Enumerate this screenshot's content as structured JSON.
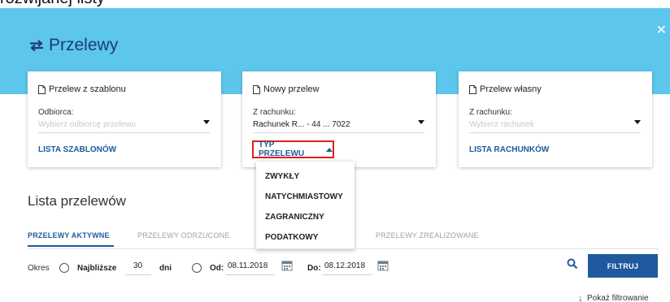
{
  "caption": "rozwijanej listy",
  "header": {
    "title": "Przelewy",
    "title_icon": "transfer-arrows-icon",
    "close_icon": "close-icon",
    "colors": {
      "banner": "#5dc6ec",
      "accent": "#1f5a9e",
      "highlight": "#e0201e"
    }
  },
  "cards": {
    "template": {
      "title": "Przelew z szablonu",
      "label": "Odbiorca:",
      "placeholder": "Wybierz odbiorcę przelewu",
      "link": "LISTA SZABLONÓW"
    },
    "new": {
      "title": "Nowy przelew",
      "label": "Z rachunku:",
      "value": "Rachunek R... - 44 ... 7022",
      "type_button": "TYP PRZELEWU"
    },
    "own": {
      "title": "Przelew własny",
      "label": "Z rachunku:",
      "placeholder": "Wybierz rachunek",
      "link": "LISTA RACHUNKÓW"
    }
  },
  "dropdown": {
    "options": [
      "ZWYKŁY",
      "NATYCHMIASTOWY",
      "ZAGRANICZNY",
      "PODATKOWY"
    ]
  },
  "list": {
    "title": "Lista przelewów",
    "tabs": [
      "PRZELEWY AKTYWNE",
      "PRZELEWY ODRZUCONE",
      "PRZELEWY ZREALIZOWANE"
    ],
    "active_tab": 0
  },
  "filter": {
    "period_label": "Okres",
    "nearest_label": "Najbliższe",
    "days_value": "30",
    "days_unit": "dni",
    "from_label": "Od:",
    "from_value": "08.11.2018",
    "to_label": "Do:",
    "to_value": "08.12.2018",
    "button": "FILTRUJ",
    "show_filtering": "Pokaż filtrowanie"
  }
}
